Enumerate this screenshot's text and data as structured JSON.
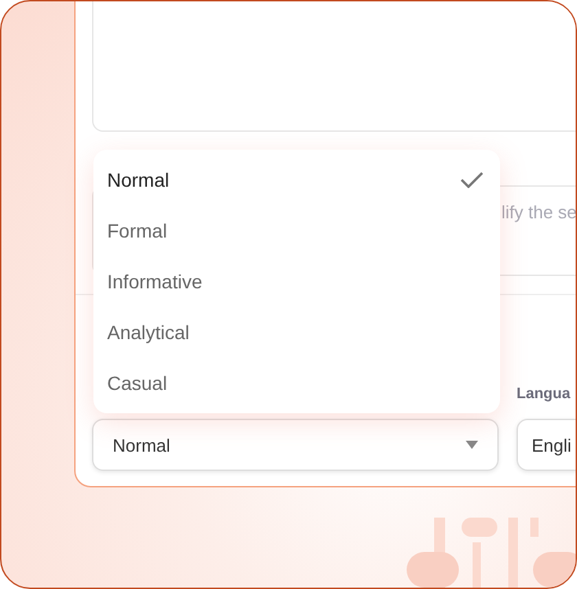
{
  "instructions_field": {
    "placeholder": "lify the se"
  },
  "tone_select": {
    "value": "Normal"
  },
  "tone_menu": {
    "options": [
      {
        "label": "Normal",
        "selected": true
      },
      {
        "label": "Formal",
        "selected": false
      },
      {
        "label": "Informative",
        "selected": false
      },
      {
        "label": "Analytical",
        "selected": false
      },
      {
        "label": "Casual",
        "selected": false
      }
    ]
  },
  "language": {
    "label": "Langua",
    "value": "Engli"
  }
}
